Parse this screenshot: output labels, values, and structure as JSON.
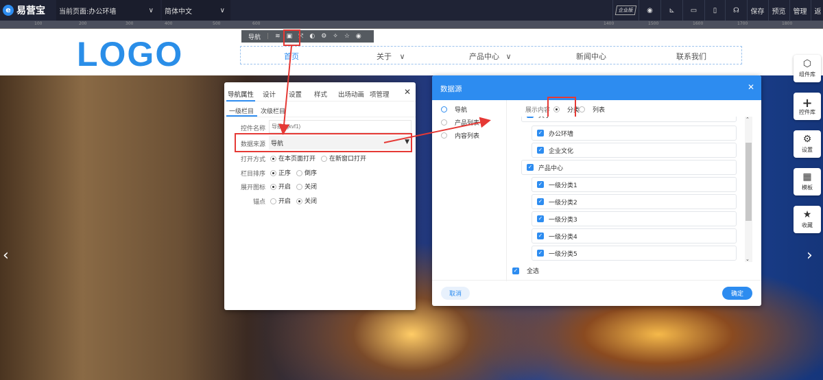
{
  "topbar": {
    "brand": "易营宝",
    "page": "当前页面:办公环墙",
    "language": "简体中文",
    "badge": "企业版",
    "save": "保存",
    "preview": "预览",
    "manage": "管理",
    "back": "返"
  },
  "ruler": [
    "100",
    "200",
    "300",
    "400",
    "500",
    "600",
    "1400",
    "1500",
    "1600",
    "1700",
    "1800"
  ],
  "site": {
    "logo": "LOGO",
    "nav": [
      "首页",
      "关于",
      "产品中心",
      "新闻中心",
      "联系我们"
    ]
  },
  "nav_toolbar": {
    "label": "导航"
  },
  "props": {
    "tabs": [
      "导航属性",
      "设计",
      "设置",
      "样式",
      "出场动画",
      "项管理"
    ],
    "subtabs": [
      "一级栏目",
      "次级栏目"
    ],
    "fields": {
      "name_label": "控件名称",
      "name_placeholder": "导航(hjkvf1)",
      "source_label": "数据来源",
      "source_value": "导航",
      "open_label": "打开方式",
      "open_opts": [
        "在本页面打开",
        "在新窗口打开"
      ],
      "order_label": "栏目排序",
      "order_opts": [
        "正序",
        "倒序"
      ],
      "expand_label": "展开图标",
      "expand_opts": [
        "开启",
        "关闭"
      ],
      "anchor_label": "锚点",
      "anchor_opts": [
        "开启",
        "关闭"
      ]
    }
  },
  "datasource": {
    "title": "数据源",
    "types": [
      "导航",
      "产品列表",
      "内容列表"
    ],
    "show_label": "展示内容",
    "show_opts": [
      "分类",
      "列表"
    ],
    "items": [
      "关于",
      "办公环墙",
      "企业文化",
      "产品中心",
      "一级分类1",
      "一级分类2",
      "一级分类3",
      "一级分类4",
      "一级分类5"
    ],
    "select_all": "全选",
    "cancel": "取消",
    "ok": "确定"
  },
  "sidebar": [
    "组件库",
    "控件库",
    "设置",
    "模板",
    "收藏"
  ],
  "colors": {
    "accent": "#2d8cf0",
    "highlight": "#e53935",
    "topbar": "#1f2335"
  }
}
